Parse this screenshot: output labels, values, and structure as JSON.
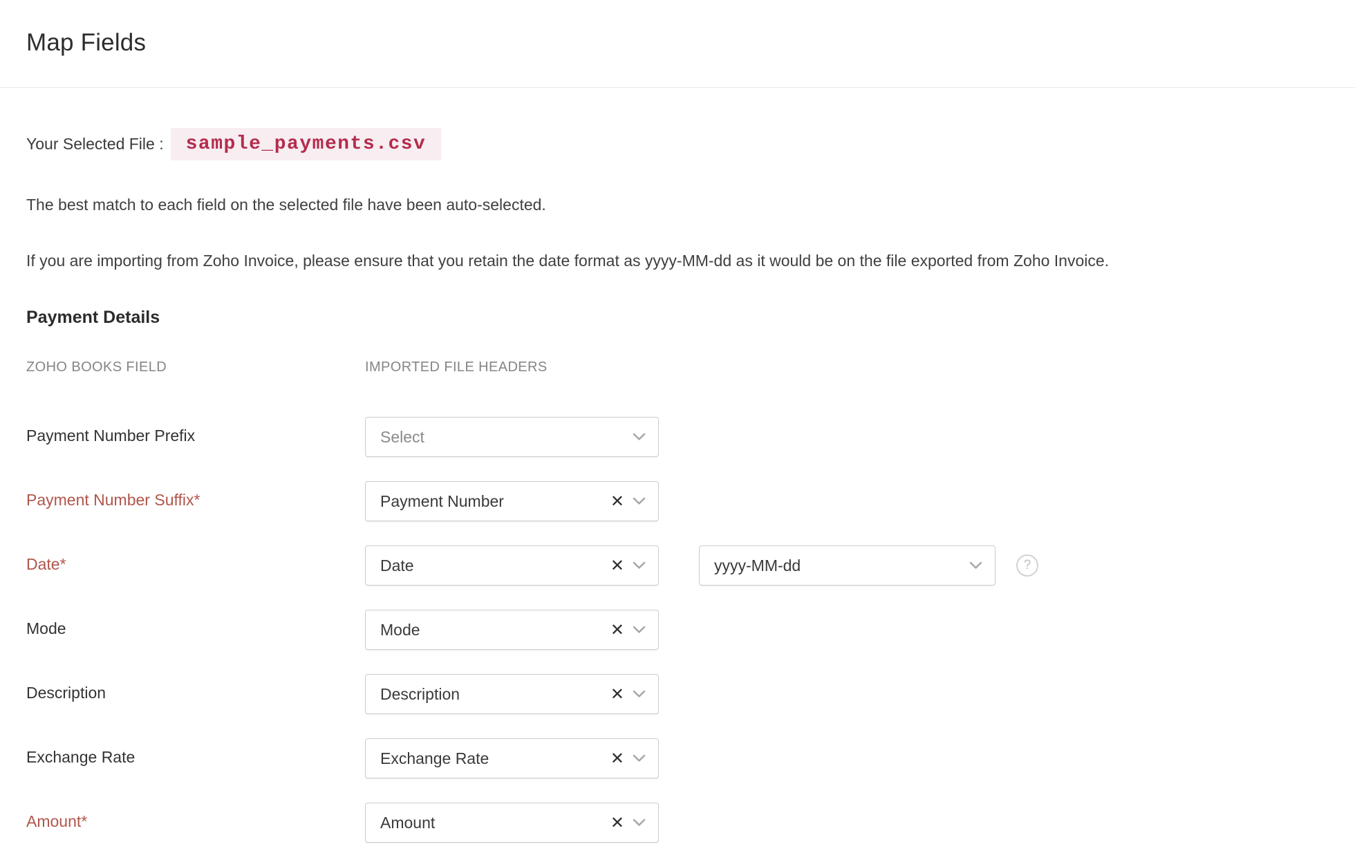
{
  "header": {
    "title": "Map Fields"
  },
  "file": {
    "label": "Your Selected File :",
    "name": "sample_payments.csv"
  },
  "notes": [
    "The best match to each field on the selected file have been auto-selected.",
    "If you are importing from Zoho Invoice, please ensure that you retain the date format as yyyy-MM-dd as it would be on the file exported from Zoho Invoice."
  ],
  "section": {
    "title": "Payment Details",
    "columns": {
      "left": "ZOHO BOOKS FIELD",
      "right": "IMPORTED FILE HEADERS"
    }
  },
  "icons": {
    "clear": "✕",
    "chevron": "chevron-down",
    "help": "?"
  },
  "colors": {
    "required_label": "#b0564c",
    "filename_text": "#b32c4e",
    "filename_bg": "#f8edf0",
    "text": "#3c3c3c",
    "muted": "#858585",
    "border": "#cccccc",
    "placeholder": "#8a8a8a"
  },
  "rows": [
    {
      "label": "Payment Number Prefix",
      "required": false,
      "value": "",
      "placeholder": "Select",
      "clearable": false
    },
    {
      "label": "Payment Number Suffix*",
      "required": true,
      "value": "Payment Number",
      "clearable": true
    },
    {
      "label": "Date*",
      "required": true,
      "value": "Date",
      "clearable": true,
      "format": {
        "value": "yyyy-MM-dd",
        "help": "?"
      }
    },
    {
      "label": "Mode",
      "required": false,
      "value": "Mode",
      "clearable": true
    },
    {
      "label": "Description",
      "required": false,
      "value": "Description",
      "clearable": true
    },
    {
      "label": "Exchange Rate",
      "required": false,
      "value": "Exchange Rate",
      "clearable": true
    },
    {
      "label": "Amount*",
      "required": true,
      "value": "Amount",
      "clearable": true
    }
  ]
}
